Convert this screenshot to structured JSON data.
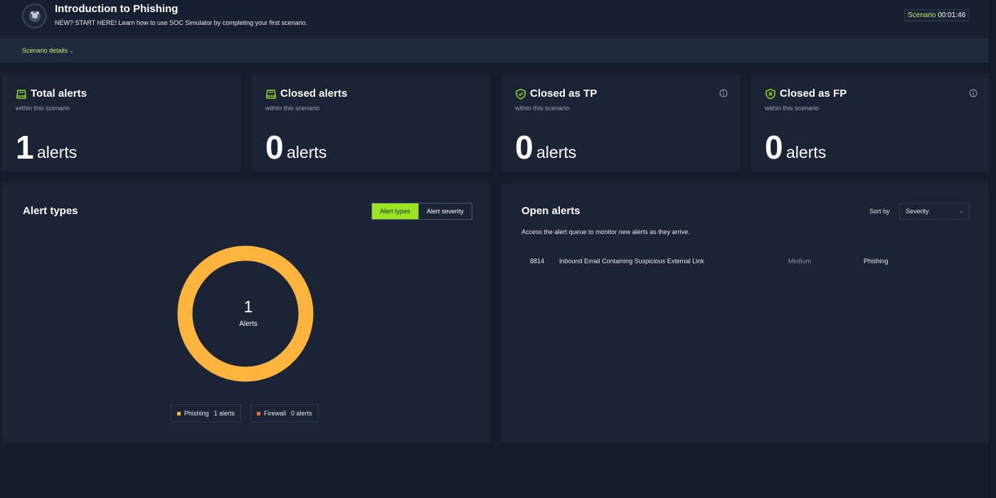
{
  "header": {
    "title": "Introduction to Phishing",
    "subtitle": "NEW? START HERE! Learn how to use SOC Simulator by completing your first scenario.",
    "timer_label": "Scenario",
    "timer_value": "00:01:46",
    "details_link": "Scenario details"
  },
  "stats": [
    {
      "title": "Total alerts",
      "subtitle": "within this scenario",
      "value": "1",
      "unit": "alerts",
      "icon": "inbox-icon"
    },
    {
      "title": "Closed alerts",
      "subtitle": "within this scenario",
      "value": "0",
      "unit": "alerts",
      "icon": "inbox-icon"
    },
    {
      "title": "Closed as TP",
      "subtitle": "within this scenario",
      "value": "0",
      "unit": "alerts",
      "icon": "shield-check-icon"
    },
    {
      "title": "Closed as FP",
      "subtitle": "within this scenario",
      "value": "0",
      "unit": "alerts",
      "icon": "shield-x-icon"
    }
  ],
  "alert_types": {
    "title": "Alert types",
    "toggle": [
      "Alert types",
      "Alert severity"
    ],
    "total": "1",
    "total_label": "Alerts",
    "legend": [
      {
        "name": "Phishing",
        "count": "1 alerts",
        "color": "#ffb43d",
        "value": 1
      },
      {
        "name": "Firewall",
        "count": "0 alerts",
        "color": "#f26d3a",
        "value": 0
      }
    ]
  },
  "open_alerts": {
    "title": "Open alerts",
    "sort_label": "Sort by",
    "sort_value": "Severity",
    "description": "Access the alert queue to monitor new alerts as they arrive.",
    "rows": [
      {
        "id": "8814",
        "name": "Inbound Email Containing Suspicious External Link",
        "severity": "Medium",
        "type": "Phishing"
      }
    ]
  },
  "colors": {
    "accent": "#9ae51f",
    "donut": "#ffb43d",
    "timer_label": "#c8f069",
    "card_bg": "#1b2436",
    "page_bg": "#151c2b"
  }
}
